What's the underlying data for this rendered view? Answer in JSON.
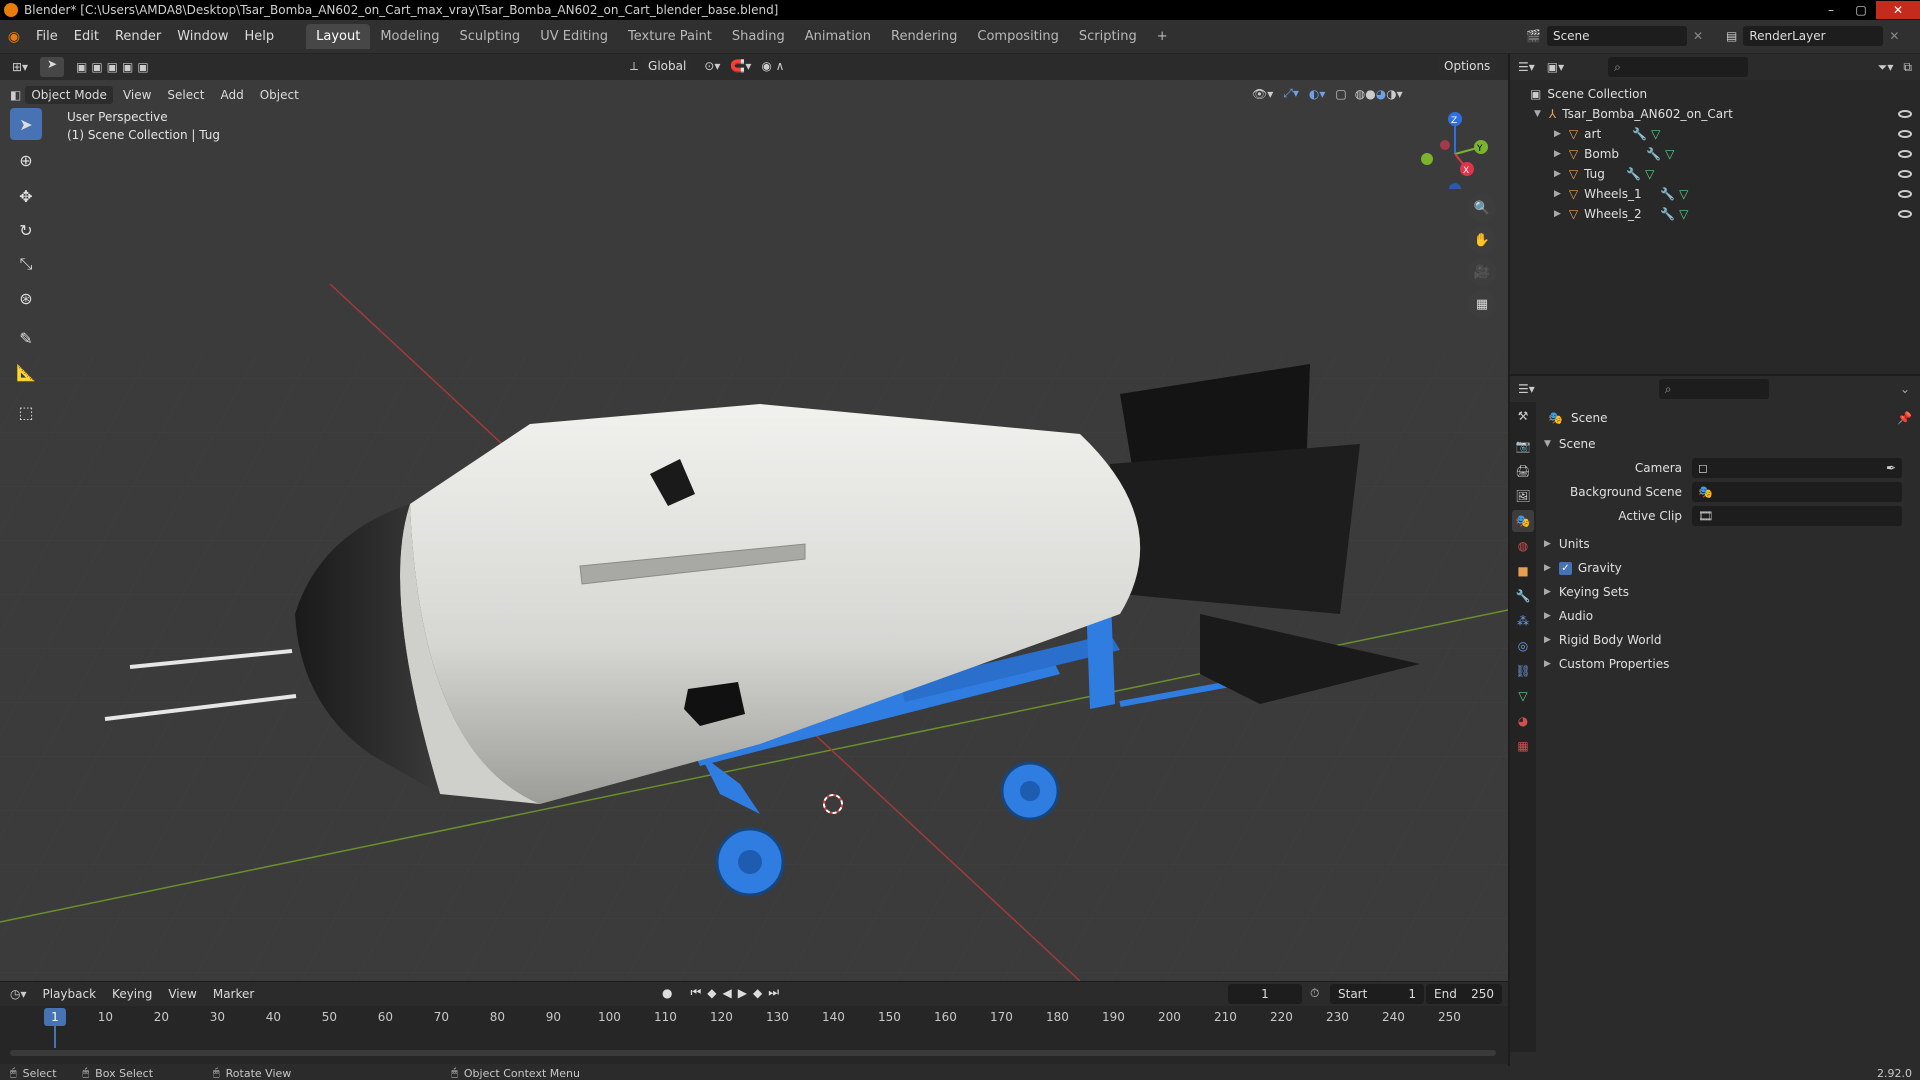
{
  "window": {
    "title": "Blender* [C:\\Users\\AMDA8\\Desktop\\Tsar_Bomba_AN602_on_Cart_max_vray\\Tsar_Bomba_AN602_on_Cart_blender_base.blend]",
    "minimize": "–",
    "maximize": "▢",
    "close": "✕"
  },
  "menu": [
    "File",
    "Edit",
    "Render",
    "Window",
    "Help"
  ],
  "workspaces": [
    "Layout",
    "Modeling",
    "Sculpting",
    "UV Editing",
    "Texture Paint",
    "Shading",
    "Animation",
    "Rendering",
    "Compositing",
    "Scripting"
  ],
  "workspace_add": "+",
  "scene": {
    "name": "Scene",
    "render_layer": "RenderLayer"
  },
  "viewport": {
    "transform": "Global",
    "options": "Options",
    "mode": "Object Mode",
    "menus": [
      "View",
      "Select",
      "Add",
      "Object"
    ],
    "overlay_title": "User Perspective",
    "overlay_sub": "(1) Scene Collection | Tug",
    "gizmo": {
      "z": "Z",
      "y": "Y",
      "x": "X"
    }
  },
  "outliner": {
    "root": "Scene Collection",
    "collection": "Tsar_Bomba_AN602_on_Cart",
    "objects": [
      "art",
      "Bomb",
      "Tug",
      "Wheels_1",
      "Wheels_2"
    ]
  },
  "properties": {
    "header": "Scene",
    "section": "Scene",
    "fields": [
      {
        "label": "Camera"
      },
      {
        "label": "Background Scene"
      },
      {
        "label": "Active Clip"
      }
    ],
    "panels": [
      "Units",
      "Gravity",
      "Keying Sets",
      "Audio",
      "Rigid Body World",
      "Custom Properties"
    ],
    "gravity_checked": true
  },
  "timeline": {
    "menus": [
      "Playback",
      "Keying",
      "View",
      "Marker"
    ],
    "current_frame": "1",
    "start_label": "Start",
    "start": "1",
    "end_label": "End",
    "end": "250",
    "frames": [
      "1",
      "10",
      "20",
      "30",
      "40",
      "50",
      "60",
      "70",
      "80",
      "90",
      "100",
      "110",
      "120",
      "130",
      "140",
      "150",
      "160",
      "170",
      "180",
      "190",
      "200",
      "210",
      "220",
      "230",
      "240",
      "250"
    ]
  },
  "status": {
    "select": "Select",
    "box_select": "Box Select",
    "rotate_view": "Rotate View",
    "context_menu": "Object Context Menu",
    "version": "2.92.0"
  },
  "colors": {
    "accent": "#4772b3",
    "cart": "#2f7de1",
    "bomb": "#d9d9d6",
    "orange": "#e87d0d"
  }
}
